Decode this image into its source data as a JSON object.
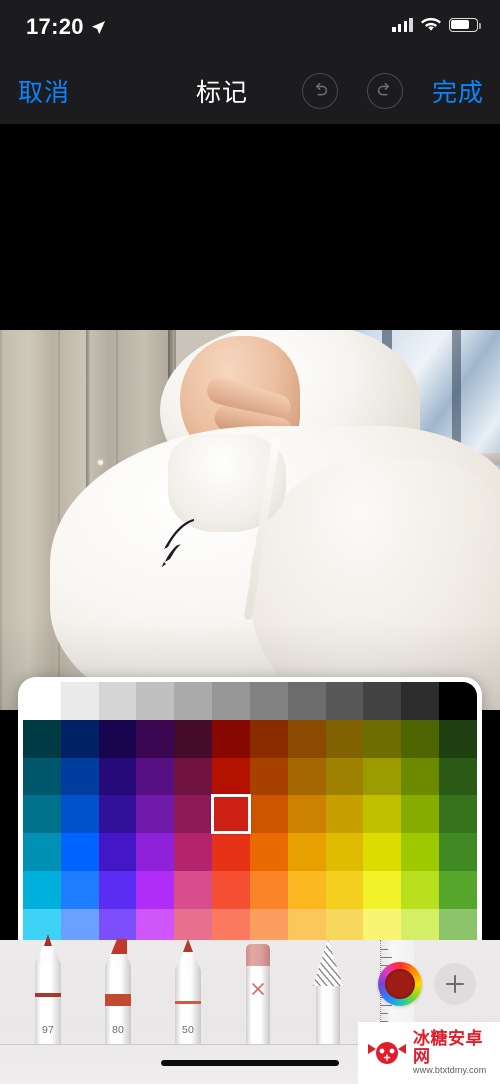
{
  "status_bar": {
    "time": "17:20",
    "location_icon": "location-arrow-icon",
    "signal_icon": "cellular-signal-icon",
    "wifi_icon": "wifi-icon",
    "battery_icon": "battery-icon",
    "battery_level": "64"
  },
  "nav_bar": {
    "cancel_label": "取消",
    "title": "标记",
    "done_label": "完成",
    "undo_icon": "undo-icon",
    "redo_icon": "redo-icon",
    "accent_color": "#0a84ff",
    "background_color": "#1c1c1e"
  },
  "palette": {
    "selected_color": "#cc2014",
    "selected_row": 3,
    "selected_col": 6,
    "columns": 12,
    "rows": 10,
    "grid": [
      [
        "#ffffff",
        "#eaeaea",
        "#d5d5d5",
        "#c0c0c0",
        "#ababab",
        "#969696",
        "#818181",
        "#6c6c6c",
        "#575757",
        "#424242",
        "#2d2d2d",
        "#000000"
      ],
      [
        "#003a44",
        "#002265",
        "#190450",
        "#3b0753",
        "#460b2b",
        "#870800",
        "#8a2b00",
        "#8a4a00",
        "#806200",
        "#6e6e00",
        "#4e6400",
        "#1e4010"
      ],
      [
        "#00566a",
        "#003d9e",
        "#260a7a",
        "#561082",
        "#701341",
        "#b41100",
        "#a84100",
        "#a56800",
        "#9e8100",
        "#9b9b00",
        "#6b8a00",
        "#2b5a16"
      ],
      [
        "#00718b",
        "#0052cc",
        "#331099",
        "#6f1aa8",
        "#8e1b56",
        "#cc2014",
        "#cc5500",
        "#cc8200",
        "#c79f00",
        "#c0c000",
        "#86ac00",
        "#37731d"
      ],
      [
        "#0091b4",
        "#0065ff",
        "#4317c6",
        "#8f21d8",
        "#b4246e",
        "#e63317",
        "#e86a00",
        "#e8a000",
        "#e0bc00",
        "#dcdc00",
        "#9ec800",
        "#418a23"
      ],
      [
        "#00b0dc",
        "#1f7dff",
        "#5b2df2",
        "#b02cf7",
        "#d84d8c",
        "#f44f33",
        "#fa8428",
        "#fab71f",
        "#f5cf1f",
        "#f2f22a",
        "#b9e01f",
        "#57a62c"
      ],
      [
        "#3fd2f7",
        "#6aa0ff",
        "#7c4dfb",
        "#cf56fb",
        "#e8708f",
        "#fb7a60",
        "#fc9f5e",
        "#fcc75a",
        "#f8d85c",
        "#f9f471",
        "#d4ee66",
        "#8bc46a"
      ],
      [
        "#86e4fb",
        "#a0c2ff",
        "#ab8bfc",
        "#e08ffd",
        "#f0a0b6",
        "#fcab9c",
        "#fdc096",
        "#fdd79a",
        "#fae39c",
        "#fbf8a6",
        "#e4f4a1",
        "#b2d9a1"
      ],
      [
        "#c0effd",
        "#cfdfff",
        "#d4c6fe",
        "#eec8fe",
        "#f8d3dd",
        "#fdd8cf",
        "#fee0cd",
        "#fee8ce",
        "#fcf1cf",
        "#fdfbd4",
        "#f1f9d2",
        "#d7ead0"
      ],
      [
        "#e2f7fe",
        "#e9f1ff",
        "#ece3ff",
        "#f7e5ff",
        "#fceaef",
        "#fef0eb",
        "#fef3e9",
        "#fff4e9",
        "#fef9e9",
        "#fefde9",
        "#f8fce9",
        "#ecf5ea"
      ]
    ]
  },
  "toolbar": {
    "tools": [
      {
        "name": "pen-tool",
        "label": "97",
        "selected": false
      },
      {
        "name": "marker-tool",
        "label": "80",
        "selected": false
      },
      {
        "name": "pencil-tool",
        "label": "50",
        "selected": false
      },
      {
        "name": "eraser-tool",
        "label": "",
        "selected": false
      },
      {
        "name": "shading-tool",
        "label": "",
        "selected": false
      },
      {
        "name": "ruler-tool",
        "label": "",
        "selected": false
      }
    ],
    "color_wheel_name": "color-wheel-button",
    "current_color": "#9d1d14",
    "add_label": "+",
    "add_name": "add-tool-button"
  },
  "watermark": {
    "title": "冰糖安卓网",
    "url": "www.btxtdmy.com"
  }
}
